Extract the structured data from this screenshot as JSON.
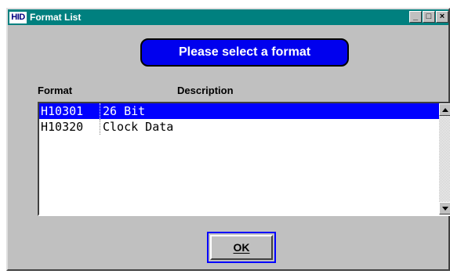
{
  "window": {
    "icon_text": "HID",
    "title": "Format List",
    "title_buttons": [
      "_",
      "□",
      "×"
    ]
  },
  "banner": {
    "text": "Please select a format"
  },
  "list": {
    "headers": {
      "format": "Format",
      "description": "Description"
    },
    "rows": [
      {
        "format": "H10301",
        "description": "26 Bit",
        "selected": true
      },
      {
        "format": "H10320",
        "description": "Clock Data",
        "selected": false
      }
    ]
  },
  "buttons": {
    "ok_label": "OK"
  },
  "colors": {
    "titlebar": "#00807f",
    "banner": "#0000ee",
    "selection": "#0000ff",
    "window_face": "#c0c0c0"
  }
}
